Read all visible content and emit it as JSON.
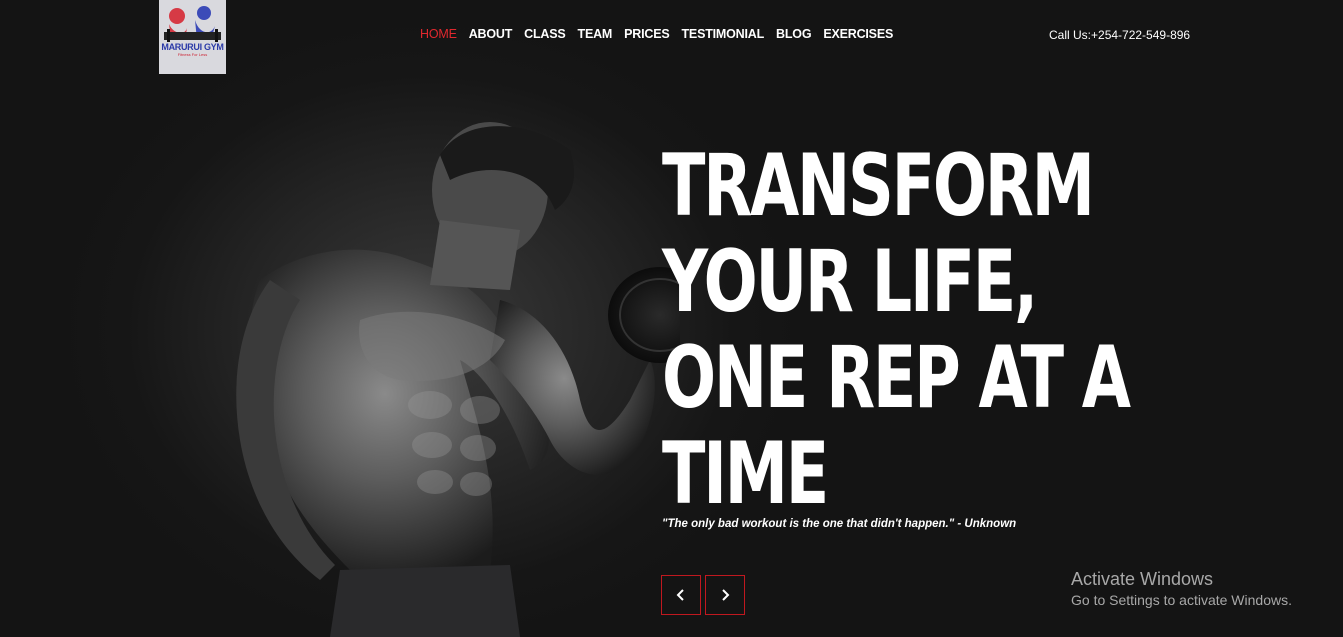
{
  "brand": {
    "name": "MARURUI GYM",
    "tagline": "Fitness For Less",
    "colors": {
      "accent": "#e0282e",
      "logo_blue": "#2b3aa8",
      "background": "#141414"
    }
  },
  "nav": {
    "items": [
      {
        "label": "HOME",
        "active": true
      },
      {
        "label": "ABOUT",
        "active": false
      },
      {
        "label": "CLASS",
        "active": false
      },
      {
        "label": "TEAM",
        "active": false
      },
      {
        "label": "PRICES",
        "active": false
      },
      {
        "label": "TESTIMONIAL",
        "active": false
      },
      {
        "label": "BLOG",
        "active": false
      },
      {
        "label": "EXERCISES",
        "active": false
      }
    ]
  },
  "contact": {
    "call_text": "Call Us:+254-722-549-896"
  },
  "hero": {
    "headline_lines": [
      "TRANSFORM",
      "YOUR LIFE,",
      "ONE REP AT A",
      "TIME"
    ],
    "quote": "\"The only bad workout is the one that didn't happen.\" - Unknown",
    "prev_icon": "chevron-left-icon",
    "next_icon": "chevron-right-icon"
  },
  "watermark": {
    "title": "Activate Windows",
    "subtitle": "Go to Settings to activate Windows."
  }
}
